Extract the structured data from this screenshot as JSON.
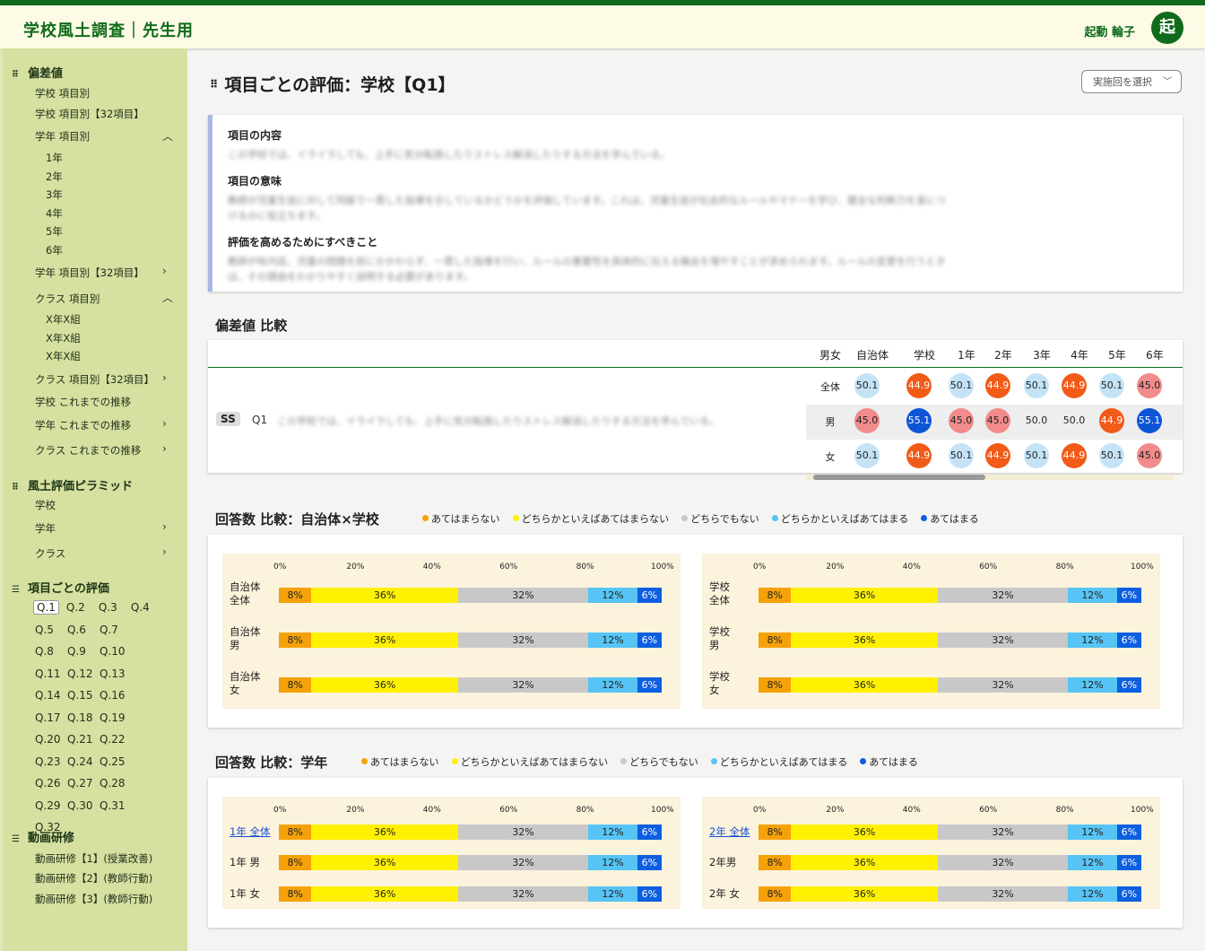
{
  "app": {
    "title": "学校風土調査｜先生用",
    "user_name": "起動 輪子",
    "avatar_initial": "起"
  },
  "sidebar": {
    "sections": [
      {
        "title": "偏差値",
        "icon": "grid-dots-icon"
      },
      {
        "title": "風土評価ピラミッド",
        "icon": "grid-dots-icon"
      },
      {
        "title": "項目ごとの評価",
        "icon": "list-icon"
      },
      {
        "title": "動画研修",
        "icon": "list-icon"
      }
    ],
    "deviation_items": [
      "学校 項目別",
      "学校 項目別【32項目】",
      "学年 項目別",
      "1年",
      "2年",
      "3年",
      "4年",
      "5年",
      "6年",
      "学年 項目別【32項目】",
      "クラス 項目別",
      "X年X組",
      "X年X組",
      "X年X組",
      "クラス 項目別【32項目】",
      "学校 これまでの推移",
      "学年 これまでの推移",
      "クラス これまでの推移"
    ],
    "pyramid_items": [
      "学校",
      "学年",
      "クラス"
    ],
    "questions": [
      "Q.1",
      "Q.2",
      "Q.3",
      "Q.4",
      "Q.5",
      "Q.6",
      "Q.7",
      "Q.8",
      "Q.9",
      "Q.10",
      "Q.11",
      "Q.12",
      "Q.13",
      "Q.14",
      "Q.15",
      "Q.16",
      "Q.17",
      "Q.18",
      "Q.19",
      "Q.20",
      "Q.21",
      "Q.22",
      "Q.23",
      "Q.24",
      "Q.25",
      "Q.26",
      "Q.27",
      "Q.28",
      "Q.29",
      "Q.30",
      "Q.31",
      "Q.32"
    ],
    "active_question": "Q.1",
    "video_items": [
      "動画研修【1】(授業改善)",
      "動画研修【2】(教師行動)",
      "動画研修【3】(教師行動)"
    ]
  },
  "main": {
    "page_title": "項目ごとの評価：学校【Q1】",
    "round_select_label": "実施回を選択",
    "info": {
      "content_heading": "項目の内容",
      "content_text": "この学校では、イライラしても、上手に気分転換したりストレス解消したりする方法を学んでいる。",
      "meaning_heading": "項目の意味",
      "meaning_text_1": "教師が児童生徒に対して同級で一貫した指導を示しているかどうかを評価しています。これは、児童生徒が社会的なルールやマナーを学び、健全な判断力を身につ",
      "meaning_text_2": "けるのに役立ちます。",
      "improve_heading": "評価を高めるためにすべきこと",
      "improve_text_1": "教師が校内巡、児童の問題を前にかかわらず、一貫した指導を行い、ルールの重要性を具体的に伝える機会を増やすことが求められます。ルールの変更を行うとき",
      "improve_text_2": "は、その理由をわかりやすく説明する必要があります。"
    },
    "deviation": {
      "title": "偏差値 比較",
      "headers": [
        "男女",
        "自治体",
        "学校",
        "1年",
        "2年",
        "3年",
        "4年",
        "5年",
        "6年"
      ],
      "ss_label": "SS",
      "question_label": "Q1",
      "question_text": "この学校では、イライラしても、上手に気分転換したりストレス解消したりする方法を学んでいる。",
      "rows": [
        {
          "sex": "全体",
          "values": [
            "50.1",
            "44.9",
            "50.1",
            "44.9",
            "50.1",
            "44.9",
            "50.1",
            "45.0"
          ],
          "tones": [
            "light",
            "orange",
            "light",
            "orange",
            "light",
            "orange",
            "light",
            "pink"
          ]
        },
        {
          "sex": "男",
          "values": [
            "45.0",
            "55.1",
            "45.0",
            "45.0",
            "50.0",
            "50.0",
            "44.9",
            "55.1"
          ],
          "tones": [
            "pink",
            "blue",
            "pink",
            "pink",
            "plain",
            "plain",
            "orange",
            "blue"
          ]
        },
        {
          "sex": "女",
          "values": [
            "50.1",
            "44.9",
            "50.1",
            "44.9",
            "50.1",
            "44.9",
            "50.1",
            "45.0"
          ],
          "tones": [
            "light",
            "orange",
            "light",
            "orange",
            "light",
            "orange",
            "light",
            "pink"
          ]
        }
      ]
    },
    "legend": [
      "あてはまらない",
      "どちらかといえばあてはまらない",
      "どちらでもない",
      "どちらかといえばあてはまる",
      "あてはまる"
    ],
    "colors": {
      "c1": "#f5a20a",
      "c2": "#fff100",
      "c3": "#c8c8c8",
      "c4": "#56c4f5",
      "c5": "#0d5fe0",
      "brand": "#0f6b1b",
      "sidebar": "#d6e0a0"
    },
    "ticks": [
      "0%",
      "20%",
      "40%",
      "60%",
      "80%",
      "100%"
    ],
    "compare_local": {
      "title": "回答数 比較：自治体×学校",
      "left": [
        {
          "label1": "自治体",
          "label2": "全体",
          "values": [
            8,
            36,
            32,
            12,
            6
          ]
        },
        {
          "label1": "自治体",
          "label2": "男",
          "values": [
            8,
            36,
            32,
            12,
            6
          ]
        },
        {
          "label1": "自治体",
          "label2": "女",
          "values": [
            8,
            36,
            32,
            12,
            6
          ]
        }
      ],
      "right": [
        {
          "label1": "学校",
          "label2": "全体",
          "values": [
            8,
            36,
            32,
            12,
            6
          ]
        },
        {
          "label1": "学校",
          "label2": "男",
          "values": [
            8,
            36,
            32,
            12,
            6
          ]
        },
        {
          "label1": "学校",
          "label2": "女",
          "values": [
            8,
            36,
            32,
            12,
            6
          ]
        }
      ]
    },
    "compare_grade": {
      "title": "回答数 比較：学年",
      "left": [
        {
          "label1": "1年 全体",
          "label2": "",
          "link": true,
          "values": [
            8,
            36,
            32,
            12,
            6
          ]
        },
        {
          "label1": "1年 男",
          "label2": "",
          "values": [
            8,
            36,
            32,
            12,
            6
          ]
        },
        {
          "label1": "1年 女",
          "label2": "",
          "values": [
            8,
            36,
            32,
            12,
            6
          ]
        }
      ],
      "right": [
        {
          "label1": "2年 全体",
          "label2": "",
          "link": true,
          "values": [
            8,
            36,
            32,
            12,
            6
          ]
        },
        {
          "label1": "2年男",
          "label2": "",
          "values": [
            8,
            36,
            32,
            12,
            6
          ]
        },
        {
          "label1": "2年 女",
          "label2": "",
          "values": [
            8,
            36,
            32,
            12,
            6
          ]
        }
      ]
    }
  }
}
